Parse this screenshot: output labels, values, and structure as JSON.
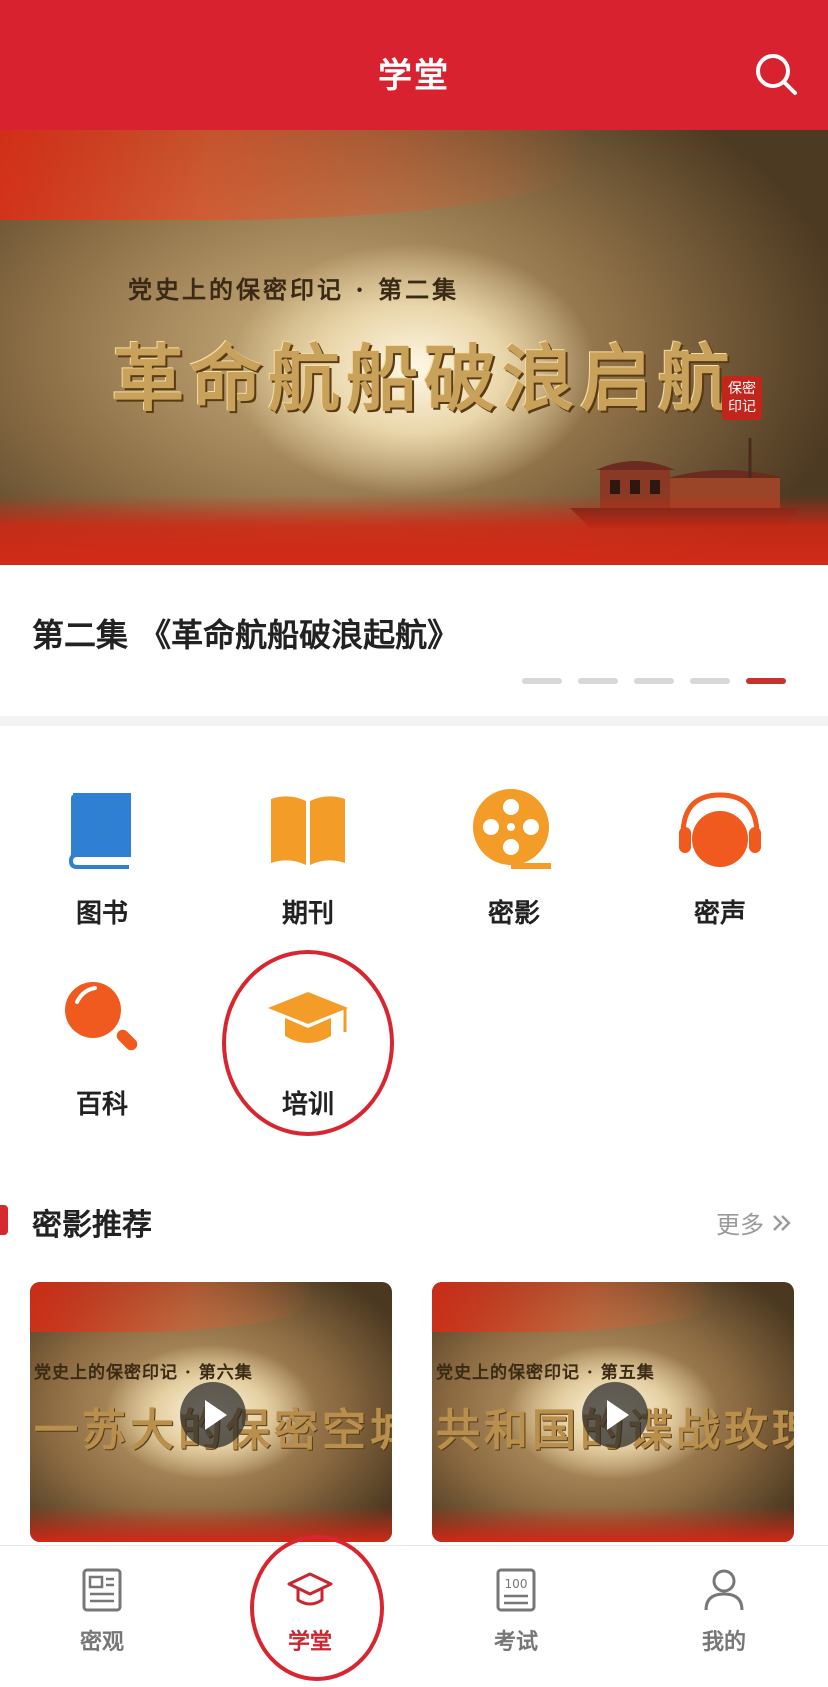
{
  "header": {
    "title": "学堂"
  },
  "banner": {
    "subtitle": "党史上的保密印记 · 第二集",
    "main_title": "革命航船破浪启航",
    "seal": "保密印记"
  },
  "caption": {
    "text": "第二集 《革命航船破浪起航》"
  },
  "carousel": {
    "count": 5,
    "active_index": 5
  },
  "categories": [
    {
      "label": "图书",
      "icon": "book-icon"
    },
    {
      "label": "期刊",
      "icon": "open-book-icon"
    },
    {
      "label": "密影",
      "icon": "film-reel-icon"
    },
    {
      "label": "密声",
      "icon": "headphones-icon"
    },
    {
      "label": "百科",
      "icon": "magnifier-icon"
    },
    {
      "label": "培训",
      "icon": "graduation-cap-icon"
    }
  ],
  "recommend": {
    "title": "密影推荐",
    "more": "更多",
    "cards": [
      {
        "subtitle": "党史上的保密印记 · 第六集",
        "title": "一苏大的保密空城计"
      },
      {
        "subtitle": "党史上的保密印记 · 第五集",
        "title": "共和国的谍战玫瑰"
      }
    ]
  },
  "tabs": [
    {
      "label": "密观",
      "icon": "newspaper-icon",
      "active": false
    },
    {
      "label": "学堂",
      "icon": "graduation-cap-icon",
      "active": true
    },
    {
      "label": "考试",
      "icon": "score-sheet-icon",
      "active": false
    },
    {
      "label": "我的",
      "icon": "person-icon",
      "active": false
    }
  ],
  "colors": {
    "brand_red": "#d9222f",
    "accent_orange": "#f39c27",
    "accent_blue": "#2f7fd3",
    "accent_red_orange": "#f05a1e"
  }
}
